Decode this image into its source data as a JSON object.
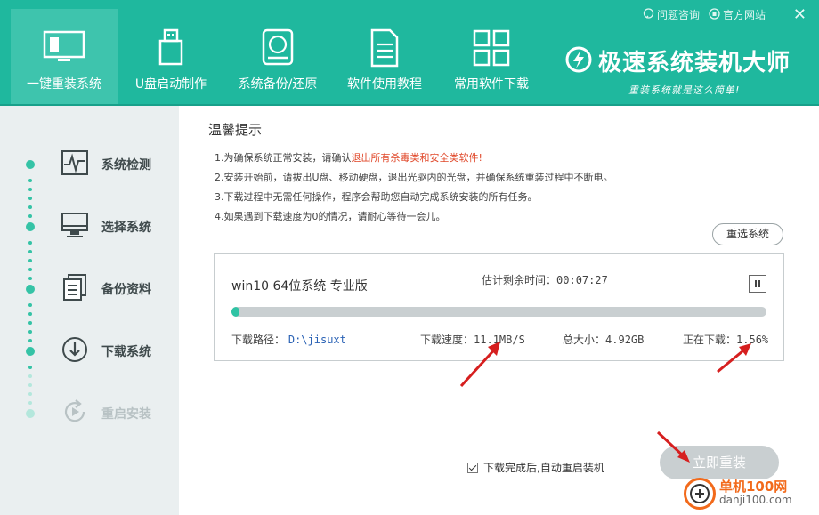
{
  "header": {
    "tabs": [
      {
        "label": "一键重装系统",
        "icon": "monitor-icon",
        "active": true
      },
      {
        "label": "U盘启动制作",
        "icon": "usb-drive-icon",
        "active": false
      },
      {
        "label": "系统备份/还原",
        "icon": "disk-backup-icon",
        "active": false
      },
      {
        "label": "软件使用教程",
        "icon": "document-icon",
        "active": false
      },
      {
        "label": "常用软件下载",
        "icon": "app-grid-icon",
        "active": false
      }
    ],
    "links": {
      "help": "问题咨询",
      "website": "官方网站"
    },
    "close": "✕",
    "brand": {
      "title": "极速系统装机大师",
      "slogan": "重装系统就是这么简单!"
    },
    "accent": "#1fb89e"
  },
  "steps": [
    {
      "label": "系统检测",
      "icon": "pulse-monitor-icon",
      "state": "done"
    },
    {
      "label": "选择系统",
      "icon": "desktop-icon",
      "state": "done"
    },
    {
      "label": "备份资料",
      "icon": "files-icon",
      "state": "done"
    },
    {
      "label": "下载系统",
      "icon": "download-circle-icon",
      "state": "active"
    },
    {
      "label": "重启安装",
      "icon": "restart-icon",
      "state": "pending"
    }
  ],
  "tips": {
    "title": "温馨提示",
    "line1_prefix": "1.为确保系统正常安装，请确认",
    "line1_warn": "退出所有杀毒类和安全类软件!",
    "line2": "2.安装开始前，请拔出U盘、移动硬盘，退出光驱内的光盘，并确保系统重装过程中不断电。",
    "line3": "3.下载过程中无需任何操作，程序会帮助您自动完成系统安装的所有任务。",
    "line4": "4.如果遇到下载速度为0的情况，请耐心等待一会儿。"
  },
  "reselect_label": "重选系统",
  "download": {
    "system_name": "win10 64位系统 专业版",
    "remaining_label": "估计剩余时间：",
    "remaining_value": "00:07:27",
    "path_label": "下载路径：",
    "path_value": "D:\\jisuxt",
    "speed_label": "下载速度：",
    "speed_value": "11.1MB/S",
    "size_label": "总大小：",
    "size_value": "4.92GB",
    "progress_label": "正在下载：",
    "progress_value": "1.56%",
    "progress_fraction": 0.0156
  },
  "auto_restart_label": "下载完成后,自动重启装机",
  "install_label": "立即重装",
  "watermark": {
    "cn": "单机100网",
    "en": "danji100.com"
  }
}
